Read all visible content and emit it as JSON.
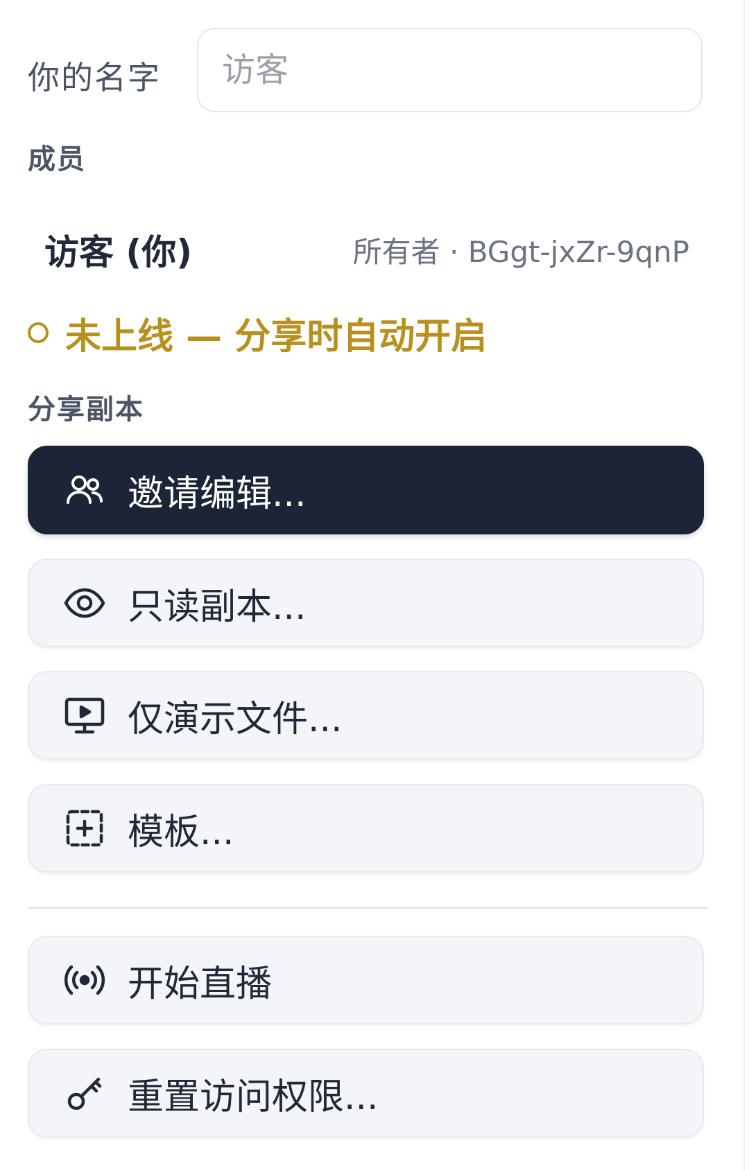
{
  "name_field": {
    "label": "你的名字",
    "placeholder": "访客"
  },
  "members": {
    "title": "成员",
    "items": [
      {
        "name": "访客 (你)",
        "meta": "所有者 · BGgt-jxZr-9qnP"
      }
    ]
  },
  "status": {
    "text": "未上线 — 分享时自动开启",
    "color": "#b8901e"
  },
  "share": {
    "title": "分享副本",
    "buttons": [
      {
        "label": "邀请编辑...",
        "icon": "users-icon"
      },
      {
        "label": "只读副本...",
        "icon": "eye-icon"
      },
      {
        "label": "仅演示文件...",
        "icon": "monitor-play-icon"
      },
      {
        "label": "模板...",
        "icon": "template-plus-icon"
      }
    ]
  },
  "actions": {
    "buttons": [
      {
        "label": "开始直播",
        "icon": "broadcast-icon"
      },
      {
        "label": "重置访问权限...",
        "icon": "key-icon"
      }
    ]
  },
  "colors": {
    "primary_button": "#1b2537",
    "secondary_button": "#f3f5f9",
    "warning": "#b8901e"
  }
}
